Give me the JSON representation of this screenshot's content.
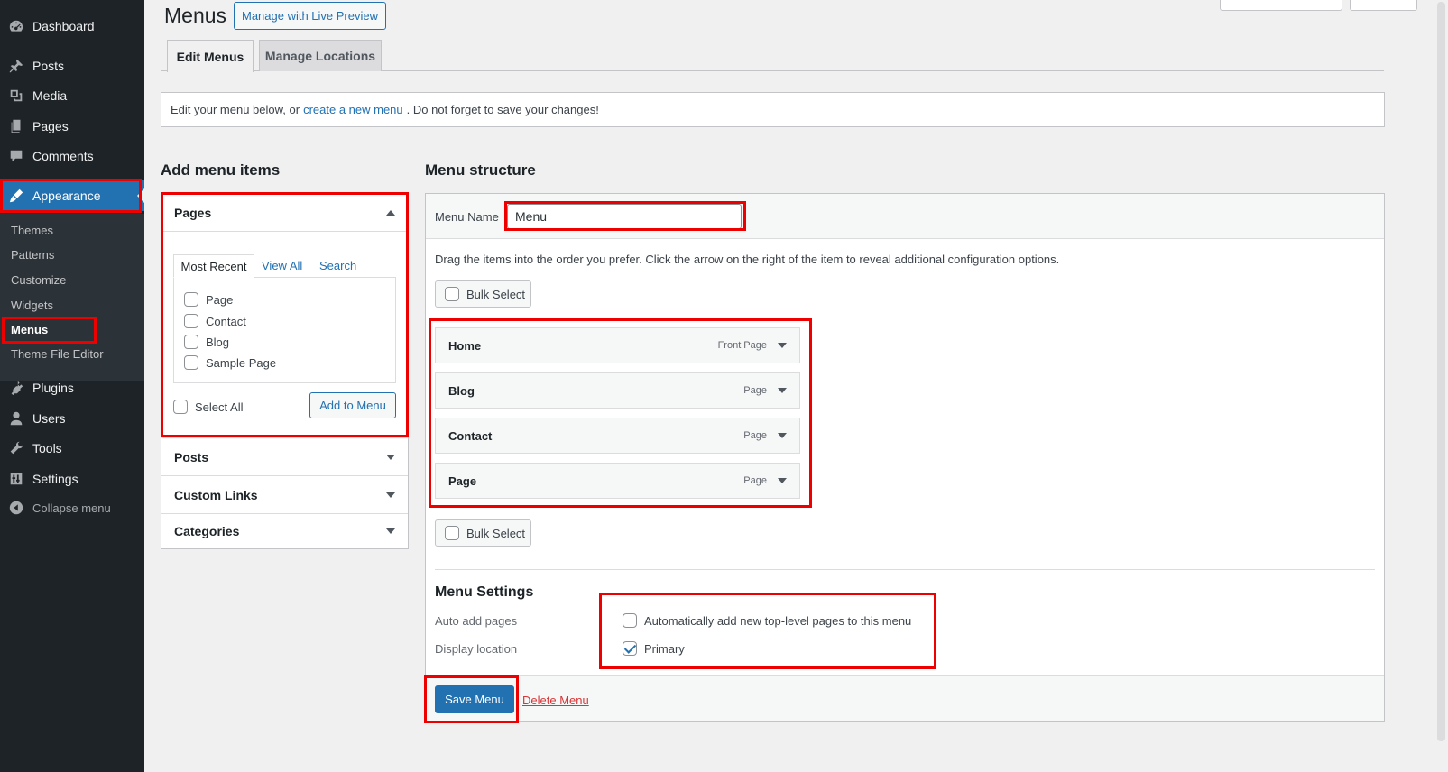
{
  "sidebar": {
    "items": [
      {
        "label": "Dashboard",
        "icon": "dashboard-icon"
      },
      {
        "label": "Posts",
        "icon": "pin-icon"
      },
      {
        "label": "Media",
        "icon": "media-icon"
      },
      {
        "label": "Pages",
        "icon": "pages-icon"
      },
      {
        "label": "Comments",
        "icon": "comment-icon"
      },
      {
        "label": "Appearance",
        "icon": "brush-icon"
      },
      {
        "label": "Plugins",
        "icon": "plugin-icon"
      },
      {
        "label": "Users",
        "icon": "users-icon"
      },
      {
        "label": "Tools",
        "icon": "wrench-icon"
      },
      {
        "label": "Settings",
        "icon": "settings-icon"
      }
    ],
    "submenu": [
      "Themes",
      "Patterns",
      "Customize",
      "Widgets",
      "Menus",
      "Theme File Editor"
    ],
    "collapse_label": "Collapse menu"
  },
  "header": {
    "title": "Menus",
    "live_preview_label": "Manage with Live Preview"
  },
  "tabs": [
    "Edit Menus",
    "Manage Locations"
  ],
  "notice": {
    "before": "Edit your menu below, or",
    "link": "create a new menu",
    "after": ". Do not forget to save your changes!"
  },
  "add_items": {
    "heading": "Add menu items",
    "pages": {
      "title": "Pages",
      "tabs": [
        "Most Recent",
        "View All",
        "Search"
      ],
      "items": [
        "Page",
        "Contact",
        "Blog",
        "Sample Page"
      ],
      "select_all_label": "Select All",
      "add_button_label": "Add to Menu"
    },
    "other_sections": [
      "Posts",
      "Custom Links",
      "Categories"
    ]
  },
  "structure": {
    "heading": "Menu structure",
    "menu_name_label": "Menu Name",
    "menu_name_value": "Menu",
    "instructions": "Drag the items into the order you prefer. Click the arrow on the right of the item to reveal additional configuration options.",
    "bulk_select_label": "Bulk Select",
    "items": [
      {
        "title": "Home",
        "type": "Front Page"
      },
      {
        "title": "Blog",
        "type": "Page"
      },
      {
        "title": "Contact",
        "type": "Page"
      },
      {
        "title": "Page",
        "type": "Page"
      }
    ]
  },
  "settings": {
    "heading": "Menu Settings",
    "auto_add_label": "Auto add pages",
    "auto_add_option": "Automatically add new top-level pages to this menu",
    "auto_add_checked": false,
    "display_location_label": "Display location",
    "location_option": "Primary",
    "location_checked": true
  },
  "footer": {
    "save_label": "Save Menu",
    "delete_label": "Delete Menu"
  },
  "colors": {
    "accent": "#2271b1",
    "sidebar_bg": "#1d2327",
    "highlight": "#ee0000"
  }
}
